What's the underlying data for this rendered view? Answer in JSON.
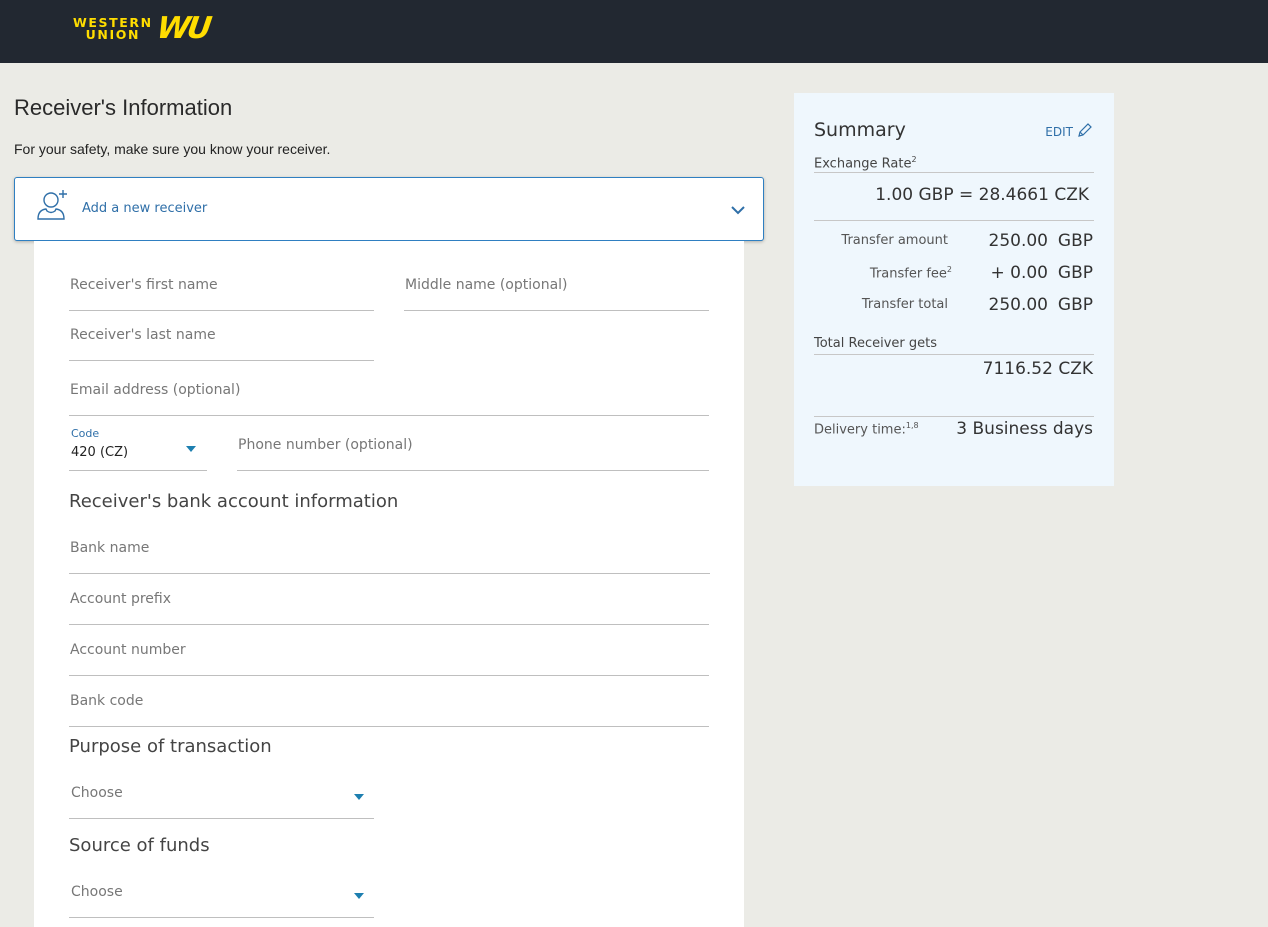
{
  "header": {
    "logo_line1": "WESTERN",
    "logo_line2": "UNION",
    "logo_mark": "WU",
    "brand_color": "#ffdd00",
    "bar_color": "#222831"
  },
  "page": {
    "title": "Receiver's Information",
    "safety_note": "For your safety, make sure you know your receiver."
  },
  "receiver_select": {
    "icon": "person-add-icon",
    "label": "Add a new receiver",
    "chevron_icon": "chevron-down-icon"
  },
  "form": {
    "first_name_placeholder": "Receiver's first name",
    "middle_name_placeholder": "Middle name (optional)",
    "last_name_placeholder": "Receiver's last name",
    "email_placeholder": "Email address (optional)",
    "code_label": "Code",
    "code_value": "420 (CZ)",
    "phone_placeholder": "Phone number (optional)",
    "bank_section_title": "Receiver's bank account information",
    "bank_name_placeholder": "Bank name",
    "account_prefix_placeholder": "Account prefix",
    "account_number_placeholder": "Account number",
    "bank_code_placeholder": "Bank code",
    "purpose_title": "Purpose of transaction",
    "purpose_value": "Choose",
    "source_title": "Source of funds",
    "source_value": "Choose"
  },
  "summary": {
    "title": "Summary",
    "edit_label": "EDIT",
    "exchange_rate_label": "Exchange Rate",
    "exchange_rate_sup": "2",
    "exchange_rate_value": "1.00 GBP = 28.4661 CZK",
    "transfer_amount_label": "Transfer amount",
    "transfer_amount_value": "250.00",
    "transfer_amount_currency": "GBP",
    "transfer_fee_label": "Transfer fee",
    "transfer_fee_sup": "2",
    "transfer_fee_value": "+ 0.00",
    "transfer_fee_currency": "GBP",
    "transfer_total_label": "Transfer total",
    "transfer_total_value": "250.00",
    "transfer_total_currency": "GBP",
    "receiver_gets_label": "Total Receiver gets",
    "receiver_gets_value": "7116.52 CZK",
    "delivery_label": "Delivery time:",
    "delivery_sup": "1,8",
    "delivery_value": "3 Business days"
  }
}
